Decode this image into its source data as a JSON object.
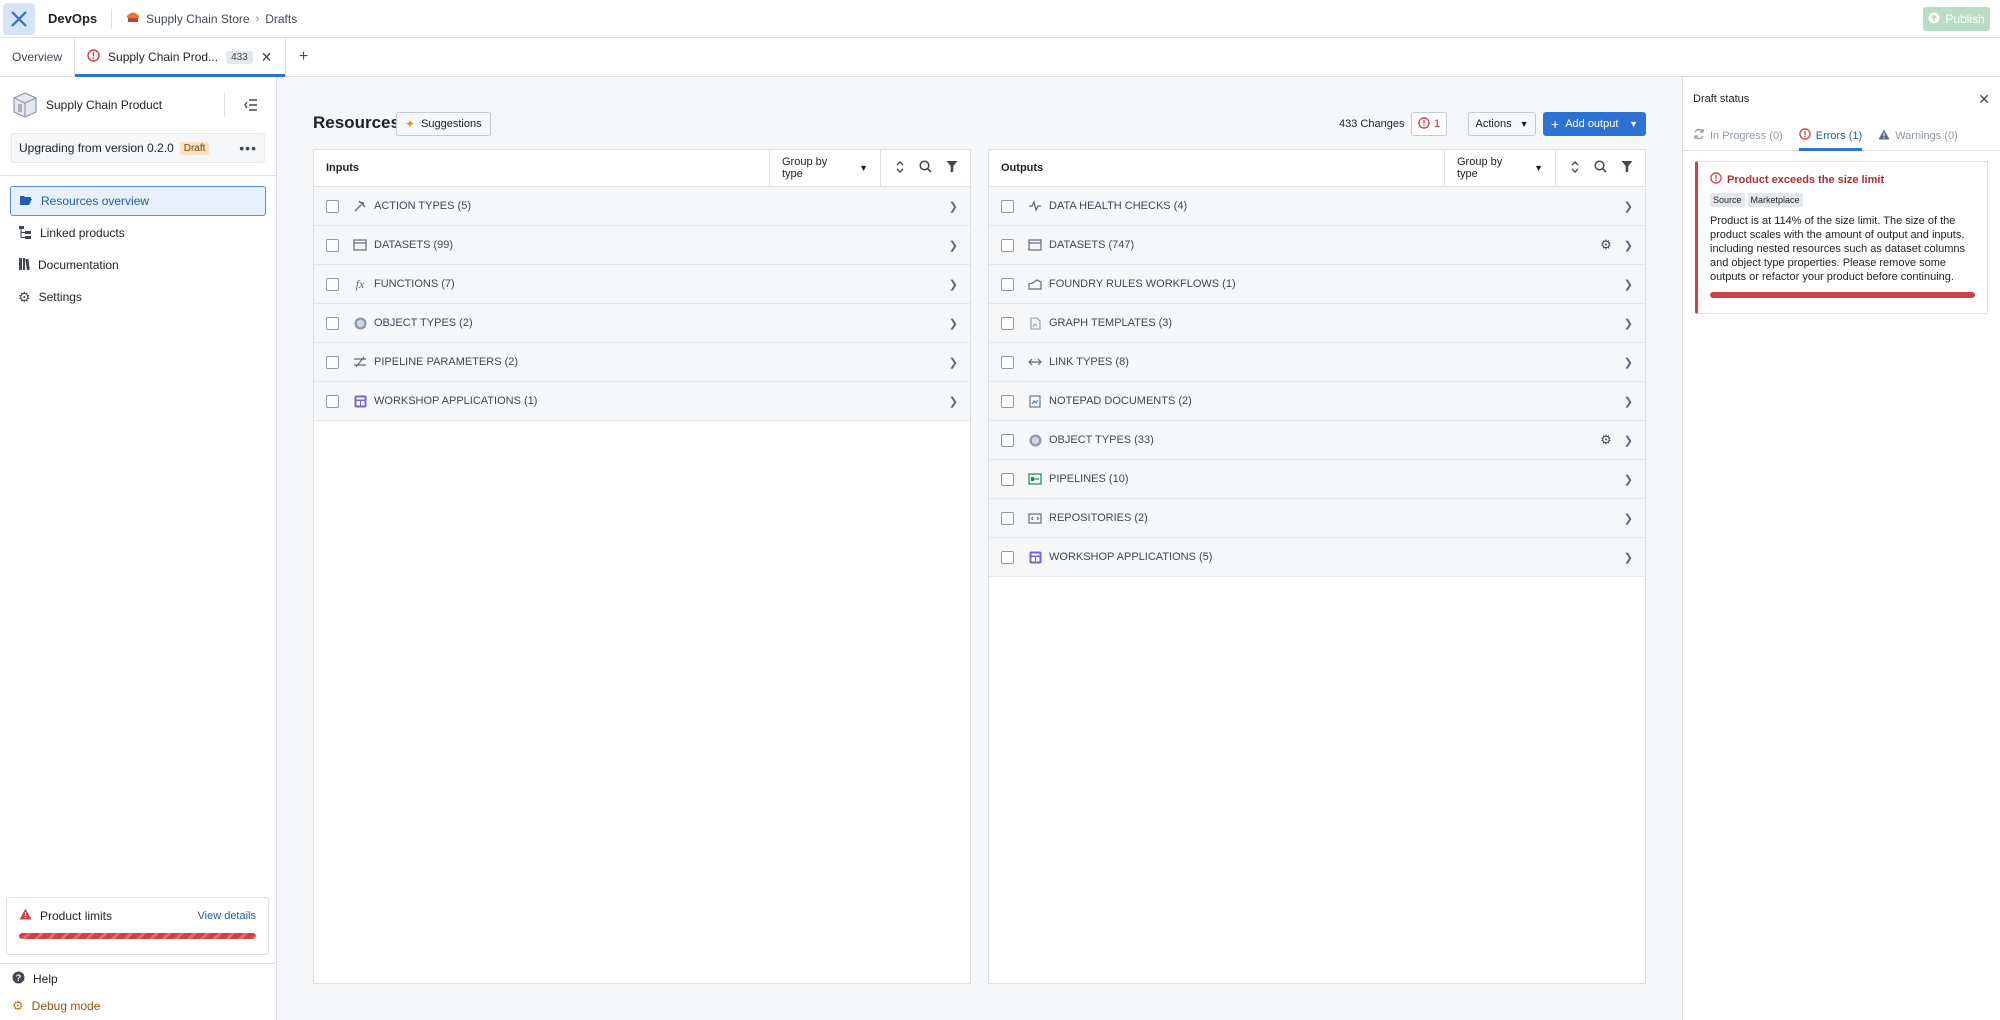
{
  "topbar": {
    "app_name": "DevOps",
    "breadcrumbs": [
      "Supply Chain Store",
      "Drafts"
    ],
    "publish_label": "Publish"
  },
  "tabs": {
    "overview_label": "Overview",
    "active_label": "Supply Chain Prod...",
    "active_badge": "433"
  },
  "sidebar": {
    "product_name": "Supply Chain Product",
    "upgrade_text": "Upgrading from version 0.2.0",
    "draft_badge": "Draft",
    "nav": [
      {
        "label": "Resources overview",
        "icon": "folder-open-icon"
      },
      {
        "label": "Linked products",
        "icon": "tree-icon"
      },
      {
        "label": "Documentation",
        "icon": "book-icon"
      },
      {
        "label": "Settings",
        "icon": "gear-icon"
      }
    ],
    "limits_label": "Product limits",
    "view_details": "View details",
    "help": "Help",
    "debug": "Debug mode"
  },
  "main": {
    "title": "Resources",
    "suggestions_label": "Suggestions",
    "changes_text": "433 Changes",
    "error_count": "1",
    "actions_label": "Actions",
    "add_output_label": "Add output",
    "inputs": {
      "title": "Inputs",
      "group_by": "Group by type",
      "rows": [
        {
          "label": "ACTION TYPES (5)",
          "icon": "action-type-icon"
        },
        {
          "label": "DATASETS (99)",
          "icon": "dataset-icon"
        },
        {
          "label": "FUNCTIONS (7)",
          "icon": "function-icon"
        },
        {
          "label": "OBJECT TYPES (2)",
          "icon": "cube-icon"
        },
        {
          "label": "PIPELINE PARAMETERS (2)",
          "icon": "parameter-icon"
        },
        {
          "label": "WORKSHOP APPLICATIONS (1)",
          "icon": "workshop-icon"
        }
      ]
    },
    "outputs": {
      "title": "Outputs",
      "group_by": "Group by type",
      "rows": [
        {
          "label": "DATA HEALTH CHECKS (4)",
          "icon": "pulse-icon"
        },
        {
          "label": "DATASETS (747)",
          "icon": "dataset-icon",
          "gear": true
        },
        {
          "label": "FOUNDRY RULES WORKFLOWS (1)",
          "icon": "rules-icon"
        },
        {
          "label": "GRAPH TEMPLATES (3)",
          "icon": "graph-template-icon"
        },
        {
          "label": "LINK TYPES (8)",
          "icon": "link-type-icon"
        },
        {
          "label": "NOTEPAD DOCUMENTS (2)",
          "icon": "notepad-icon"
        },
        {
          "label": "OBJECT TYPES (33)",
          "icon": "cube-icon",
          "gear": true
        },
        {
          "label": "PIPELINES (10)",
          "icon": "pipeline-icon"
        },
        {
          "label": "REPOSITORIES (2)",
          "icon": "repository-icon"
        },
        {
          "label": "WORKSHOP APPLICATIONS (5)",
          "icon": "workshop-icon"
        }
      ]
    }
  },
  "drawer": {
    "title": "Draft status",
    "tabs": [
      "In Progress (0)",
      "Errors (1)",
      "Warnings (0)"
    ],
    "error": {
      "title": "Product exceeds the size limit",
      "tags": [
        "Source",
        "Marketplace"
      ],
      "message": "Product is at 114% of the size limit. The size of the product scales with the amount of output and inputs, including nested resources such as dataset columns and object type properties. Please remove some outputs or refactor your product before continuing.",
      "progress_percent": 114
    }
  },
  "colors": {
    "accent": "#2d72d2",
    "danger": "#cd4246",
    "publish_disabled": "#b9dcc4"
  }
}
